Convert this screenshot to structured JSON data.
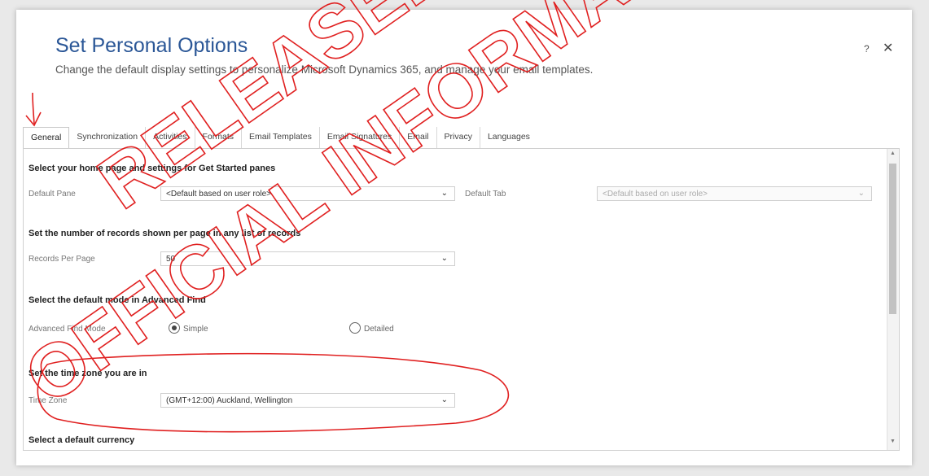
{
  "dialog": {
    "title": "Set Personal Options",
    "subtitle": "Change the default display settings to personalize Microsoft Dynamics 365, and manage your email templates.",
    "help_label": "?",
    "close_label": "✕"
  },
  "tabs": [
    {
      "label": "General",
      "active": true
    },
    {
      "label": "Synchronization"
    },
    {
      "label": "Activities"
    },
    {
      "label": "Formats"
    },
    {
      "label": "Email Templates"
    },
    {
      "label": "Email Signatures"
    },
    {
      "label": "Email"
    },
    {
      "label": "Privacy"
    },
    {
      "label": "Languages"
    }
  ],
  "sections": {
    "home": {
      "title": "Select your home page and settings for Get Started panes",
      "pane_label": "Default Pane",
      "pane_value": "<Default based on user role>",
      "tab_label": "Default Tab",
      "tab_value": "<Default based on user role>"
    },
    "records": {
      "title": "Set the number of records shown per page in any list of records",
      "label": "Records Per Page",
      "value": "50"
    },
    "advanced_find": {
      "title": "Select the default mode in Advanced Find",
      "label": "Advanced Find Mode",
      "simple_label": "Simple",
      "detailed_label": "Detailed",
      "selected": "Simple"
    },
    "timezone": {
      "title": "Set the time zone you are in",
      "label": "Time Zone",
      "value": "(GMT+12:00) Auckland, Wellington"
    },
    "currency": {
      "title": "Select a default currency"
    }
  },
  "icons": {
    "dropdown": "chevron-down-icon",
    "annotation_arrow": "red-arrow-icon"
  },
  "watermark": {
    "line1": "RELEASED",
    "line2": "OFFICIAL INFORMATION",
    "color": "#e02020"
  },
  "colors": {
    "title": "#2b5797",
    "annotation": "#e02020"
  }
}
